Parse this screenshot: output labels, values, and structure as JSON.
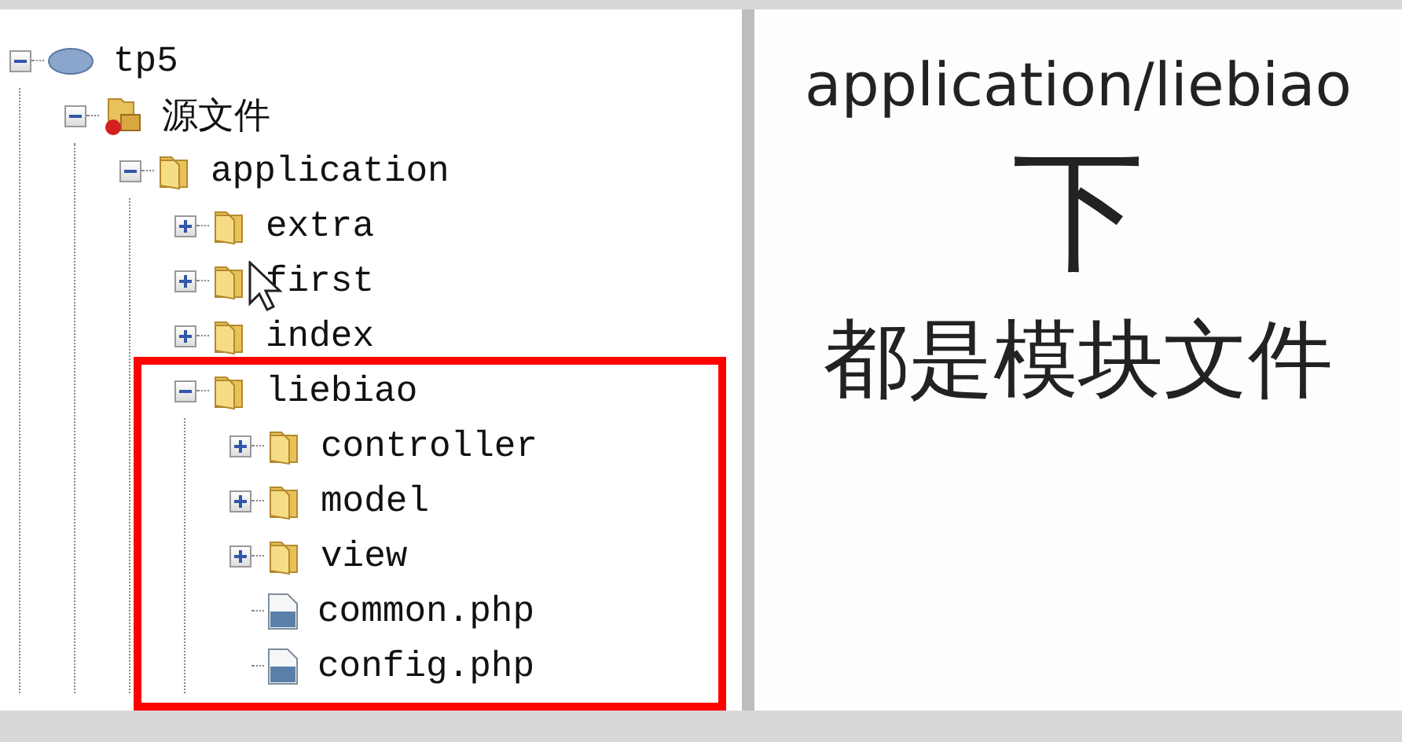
{
  "tree": [
    {
      "kind": "project",
      "label": "tp5",
      "expanded": true,
      "children": [
        {
          "kind": "source",
          "label": "源文件",
          "expanded": true,
          "children": [
            {
              "kind": "folder",
              "label": "application",
              "expanded": true,
              "children": [
                {
                  "kind": "folder",
                  "label": "extra",
                  "expanded": false
                },
                {
                  "kind": "folder",
                  "label": "first",
                  "expanded": false
                },
                {
                  "kind": "folder",
                  "label": "index",
                  "expanded": false
                },
                {
                  "kind": "folder",
                  "label": "liebiao",
                  "expanded": true,
                  "children": [
                    {
                      "kind": "folder",
                      "label": "controller",
                      "expanded": false
                    },
                    {
                      "kind": "folder",
                      "label": "model",
                      "expanded": false
                    },
                    {
                      "kind": "folder",
                      "label": "view",
                      "expanded": false
                    },
                    {
                      "kind": "file",
                      "label": "common.php"
                    },
                    {
                      "kind": "file",
                      "label": "config.php"
                    }
                  ]
                }
              ]
            }
          ]
        }
      ]
    }
  ],
  "caption": {
    "path": "application/liebiao",
    "word": "下",
    "sentence": "都是模块文件"
  }
}
